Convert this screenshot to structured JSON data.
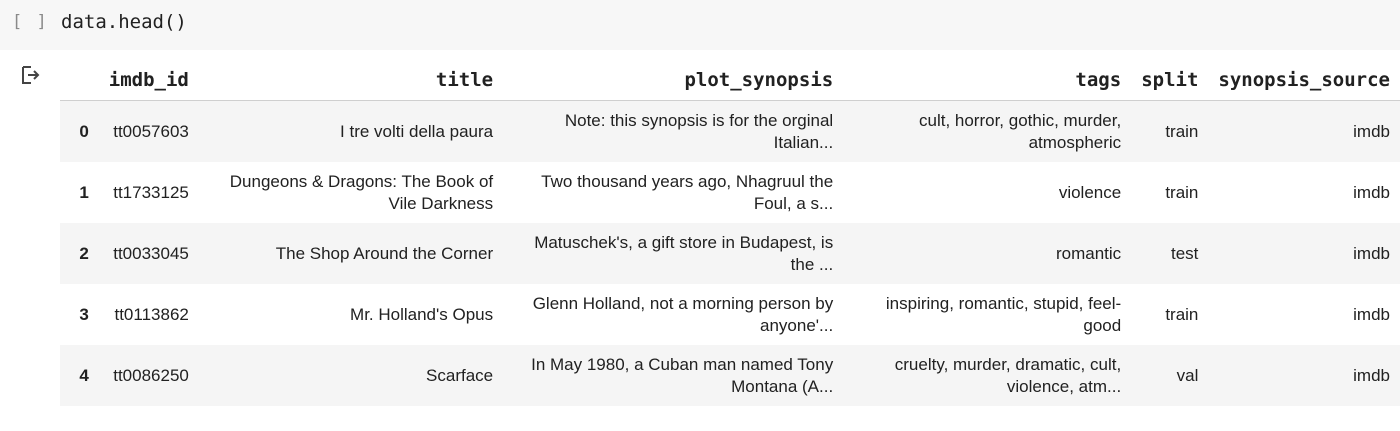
{
  "cell": {
    "run_indicator": "[ ]",
    "code": "data.head()"
  },
  "output": {
    "icon": "output-arrow-icon",
    "columns": [
      "",
      "imdb_id",
      "title",
      "plot_synopsis",
      "tags",
      "split",
      "synopsis_source"
    ],
    "rows": [
      {
        "index": "0",
        "imdb_id": "tt0057603",
        "title": "I tre volti della paura",
        "plot_synopsis": "Note: this synopsis is for the orginal Italian...",
        "tags": "cult, horror, gothic, murder, atmospheric",
        "split": "train",
        "synopsis_source": "imdb"
      },
      {
        "index": "1",
        "imdb_id": "tt1733125",
        "title": "Dungeons & Dragons: The Book of Vile Darkness",
        "plot_synopsis": "Two thousand years ago, Nhagruul the Foul, a s...",
        "tags": "violence",
        "split": "train",
        "synopsis_source": "imdb"
      },
      {
        "index": "2",
        "imdb_id": "tt0033045",
        "title": "The Shop Around the Corner",
        "plot_synopsis": "Matuschek's, a gift store in Budapest, is the ...",
        "tags": "romantic",
        "split": "test",
        "synopsis_source": "imdb"
      },
      {
        "index": "3",
        "imdb_id": "tt0113862",
        "title": "Mr. Holland's Opus",
        "plot_synopsis": "Glenn Holland, not a morning person by anyone'...",
        "tags": "inspiring, romantic, stupid, feel-good",
        "split": "train",
        "synopsis_source": "imdb"
      },
      {
        "index": "4",
        "imdb_id": "tt0086250",
        "title": "Scarface",
        "plot_synopsis": "In May 1980, a Cuban man named Tony Montana (A...",
        "tags": "cruelty, murder, dramatic, cult, violence, atm...",
        "split": "val",
        "synopsis_source": "imdb"
      }
    ]
  }
}
